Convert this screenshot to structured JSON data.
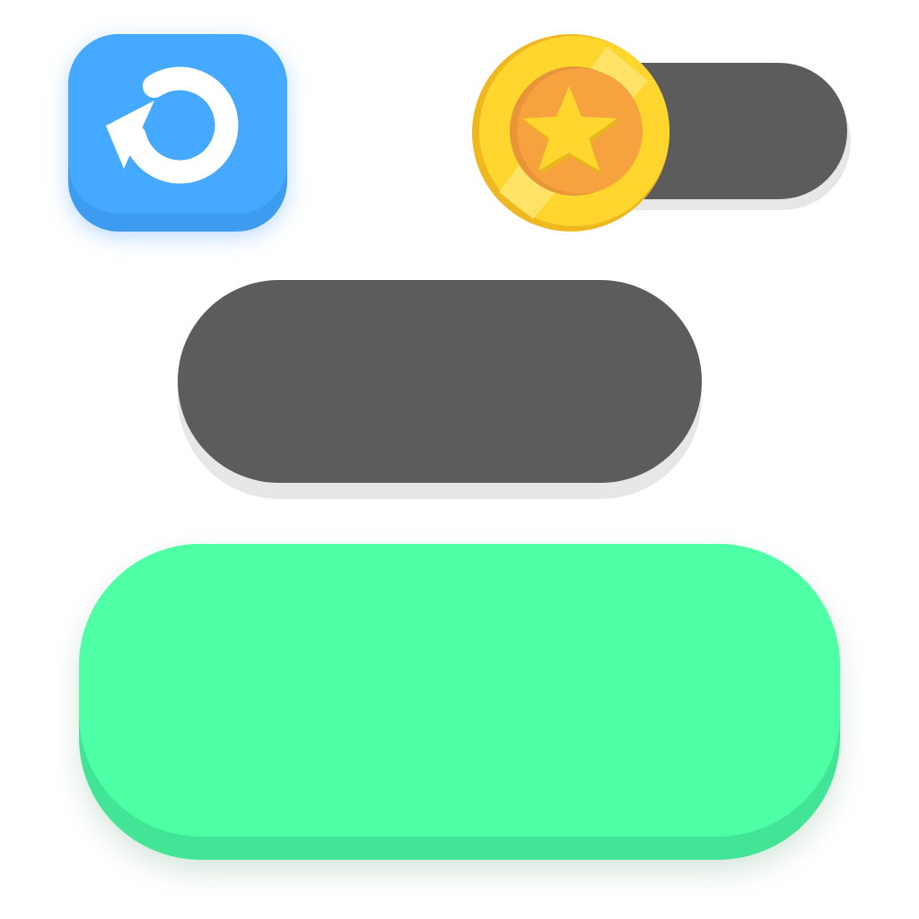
{
  "restart_button": {
    "icon": "restart-icon",
    "color": "#45A9FF",
    "shadow_color": "#3E9CF0"
  },
  "coin_counter": {
    "icon": "coin-star-icon",
    "count": "",
    "track_color": "#5C5C5C",
    "coin_color": "#FFD62E",
    "coin_center_color": "#F6A23F"
  },
  "dark_pill": {
    "label": "",
    "color": "#5C5C5C"
  },
  "green_button": {
    "label": "",
    "color": "#4FFFA6",
    "shadow_color": "#42E596"
  }
}
